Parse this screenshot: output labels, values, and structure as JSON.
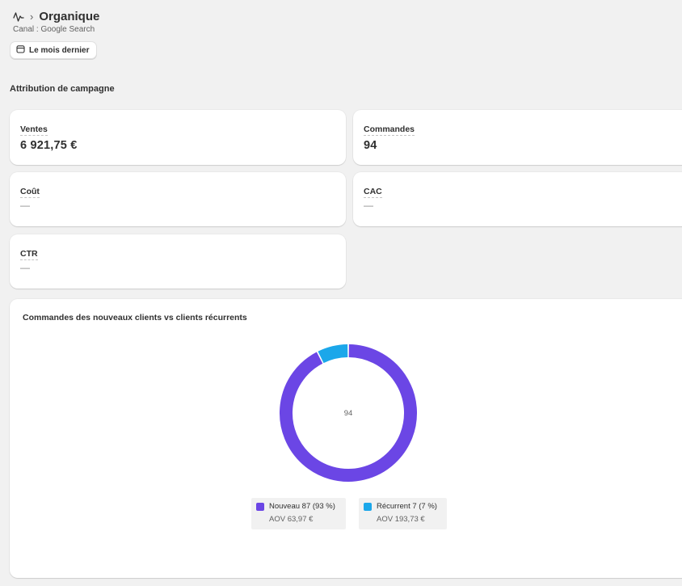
{
  "header": {
    "channel_icon": "pulse-icon",
    "breadcrumb_separator": "›",
    "title": "Organique",
    "subtitle": "Canal : Google Search"
  },
  "date_filter": {
    "icon": "calendar-icon",
    "label": "Le mois dernier"
  },
  "section": {
    "title": "Attribution de campagne"
  },
  "metrics": [
    {
      "label": "Ventes",
      "value": "6 921,75 €"
    },
    {
      "label": "Commandes",
      "value": "94"
    },
    {
      "label": "Coût",
      "value": "—"
    },
    {
      "label": "CAC",
      "value": "—"
    },
    {
      "label": "CTR",
      "value": "—"
    }
  ],
  "chart": {
    "title": "Commandes des nouveaux clients vs clients récurrents",
    "center_label": "94",
    "legend": [
      {
        "label": "Nouveau 87 (93 %)",
        "aov": "AOV 63,97 €",
        "color": "#6b46e5"
      },
      {
        "label": "Récurrent 7 (7 %)",
        "aov": "AOV 193,73 €",
        "color": "#1ba7ea"
      }
    ]
  },
  "chart_data": {
    "type": "pie",
    "title": "Commandes des nouveaux clients vs clients récurrents",
    "categories": [
      "Nouveau",
      "Récurrent"
    ],
    "values": [
      87,
      7
    ],
    "percentages": [
      93,
      7
    ],
    "aov": [
      "63,97 €",
      "193,73 €"
    ],
    "total": 94,
    "colors": [
      "#6b46e5",
      "#1ba7ea"
    ],
    "donut": true,
    "legend_position": "bottom"
  }
}
